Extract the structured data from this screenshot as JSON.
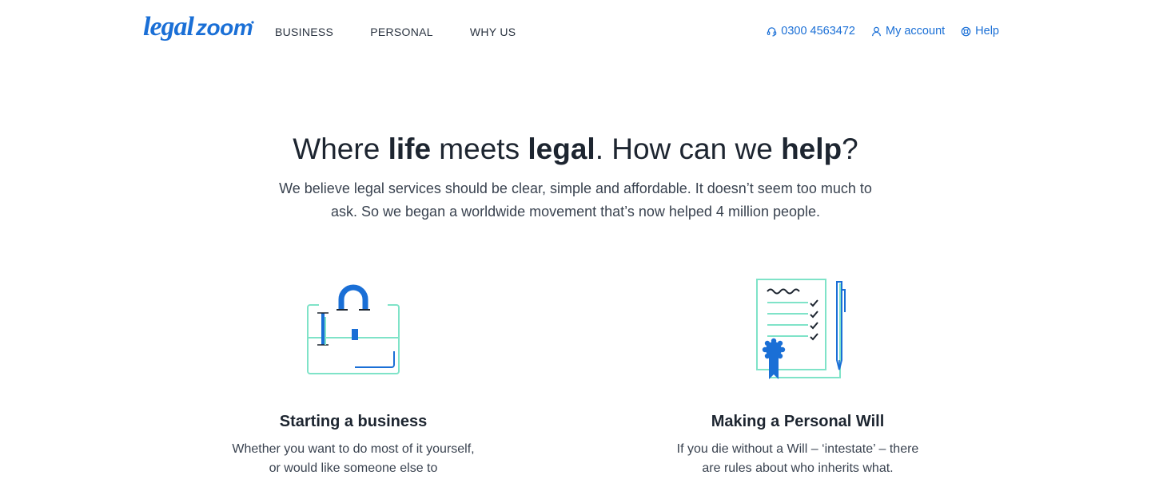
{
  "header": {
    "logo_text": "legalzoom",
    "nav": [
      {
        "label": "BUSINESS"
      },
      {
        "label": "PERSONAL"
      },
      {
        "label": "WHY US"
      }
    ],
    "phone": "0300 4563472",
    "account": "My account",
    "help": "Help"
  },
  "hero": {
    "title_1": "Where ",
    "title_2": "life",
    "title_3": " meets ",
    "title_4": "legal",
    "title_5": ". How can we ",
    "title_6": "help",
    "title_7": "?",
    "subtitle": "We believe legal services should be clear, simple and affordable. It doesn’t seem too much to ask. So we began a worldwide movement that’s now helped 4 million people."
  },
  "cards": [
    {
      "title": "Starting a business",
      "text": "Whether you want to do most of it yourself, or would like someone else to",
      "icon": "briefcase-icon"
    },
    {
      "title": "Making a Personal Will",
      "text": "If you die without a Will – ‘intestate’ – there are rules about who inherits what.",
      "icon": "will-document-icon"
    }
  ],
  "colors": {
    "brand_blue": "#1a6fd6",
    "accent_mint": "#7fe3c8",
    "text_dark": "#1d2530"
  }
}
